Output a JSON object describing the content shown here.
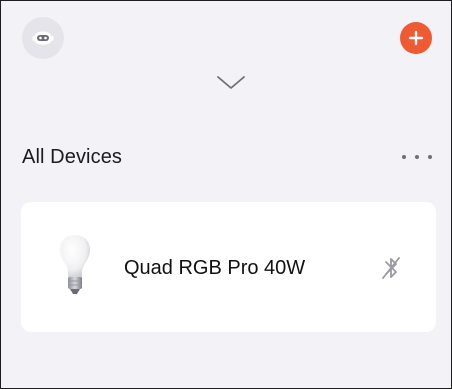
{
  "header": {
    "avatar_icon": "robot-avatar-icon",
    "add_icon": "plus-circle-icon",
    "collapse_icon": "chevron-down-icon",
    "accent_color": "#ef5a33"
  },
  "section": {
    "title": "All Devices",
    "more_icon": "more-horizontal-icon"
  },
  "devices": [
    {
      "name": "Quad RGB Pro 40W",
      "icon": "light-bulb-icon",
      "status_icon": "bluetooth-disconnected-icon"
    }
  ]
}
